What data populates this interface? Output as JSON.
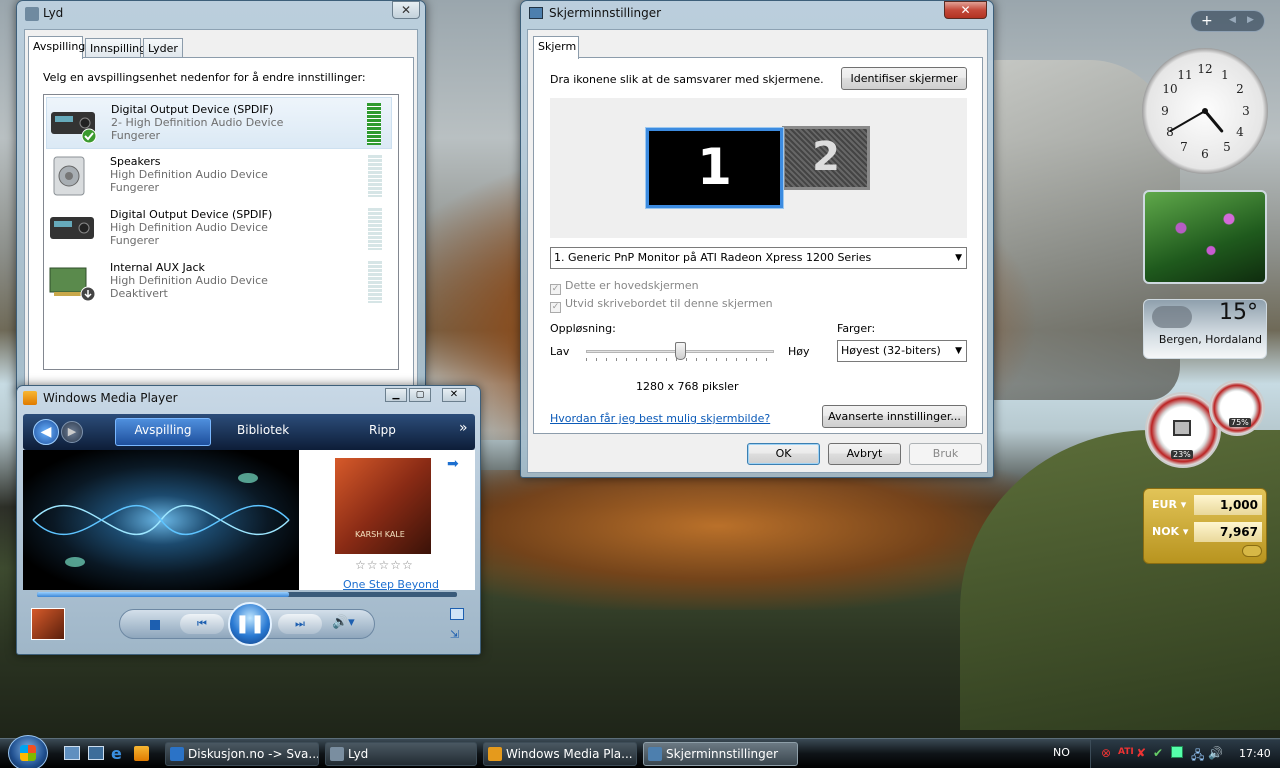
{
  "sound": {
    "title": "Lyd",
    "close": "✕",
    "tabs": [
      "Avspilling",
      "Innspilling",
      "Lyder"
    ],
    "instruction": "Velg en avspillingsenhet nedenfor for å endre innstillinger:",
    "devices": [
      {
        "name": "Digital Output Device (SPDIF)",
        "desc": "2- High Definition Audio Device",
        "status": "Fungerer",
        "icon": "spdif-device-icon",
        "default": true,
        "level": 1.0
      },
      {
        "name": "Speakers",
        "desc": "High Definition Audio Device",
        "status": "Fungerer",
        "icon": "speakers-icon",
        "default": false,
        "level": 0
      },
      {
        "name": "Digital Output Device (SPDIF)",
        "desc": "High Definition Audio Device",
        "status": "Fungerer",
        "icon": "spdif-device-icon",
        "default": false,
        "level": 0
      },
      {
        "name": "Internal AUX Jack",
        "desc": "High Definition Audio Device",
        "status": "Deaktivert",
        "icon": "sound-card-icon",
        "default": false,
        "level": 0
      }
    ]
  },
  "display": {
    "title": "Skjerminnstillinger",
    "close": "✕",
    "tab": "Skjerm",
    "instruction": "Dra ikonene slik at de samsvarer med skjermene.",
    "identify": "Identifiser skjermer",
    "monitor1": "1",
    "monitor2": "2",
    "monitor_select": "1. Generic PnP Monitor på ATI Radeon Xpress 1200 Series",
    "check_primary": "Dette er hovedskjermen",
    "check_extend": "Utvid skrivebordet til denne skjermen",
    "resolution_label": "Oppløsning:",
    "low": "Lav",
    "high": "Høy",
    "resolution_value": "1280 x 768 piksler",
    "resolution_position": 0.5,
    "colors_label": "Farger:",
    "colors_value": "Høyest (32-biters)",
    "help_link": "Hvordan får jeg best mulig skjermbilde?",
    "advanced": "Avanserte innstillinger...",
    "ok": "OK",
    "cancel": "Avbryt",
    "apply": "Bruk"
  },
  "wmp": {
    "title": "Windows Media Player",
    "tabs": [
      "Avspilling",
      "Bibliotek",
      "Ripp"
    ],
    "more": "»",
    "album_text": "KARSH KALE",
    "track": "One Step Beyond",
    "rating": "☆☆☆☆☆",
    "progress": 0.6
  },
  "gadgets": {
    "clock": {
      "hour": 4,
      "minute": 40
    },
    "weather": {
      "temp": "15°",
      "city": "Bergen, Hordaland"
    },
    "cpu": {
      "cpu": "23%",
      "mem": "75%"
    },
    "currency": [
      {
        "code": "EUR",
        "value": "1,000"
      },
      {
        "code": "NOK",
        "value": "7,967"
      }
    ],
    "sidebar_add": "+"
  },
  "taskbar": {
    "items": [
      "Diskusjon.no -> Sva...",
      "Lyd",
      "Windows Media Pla...",
      "Skjerminnstillinger"
    ],
    "lang": "NO",
    "time": "17:40"
  }
}
